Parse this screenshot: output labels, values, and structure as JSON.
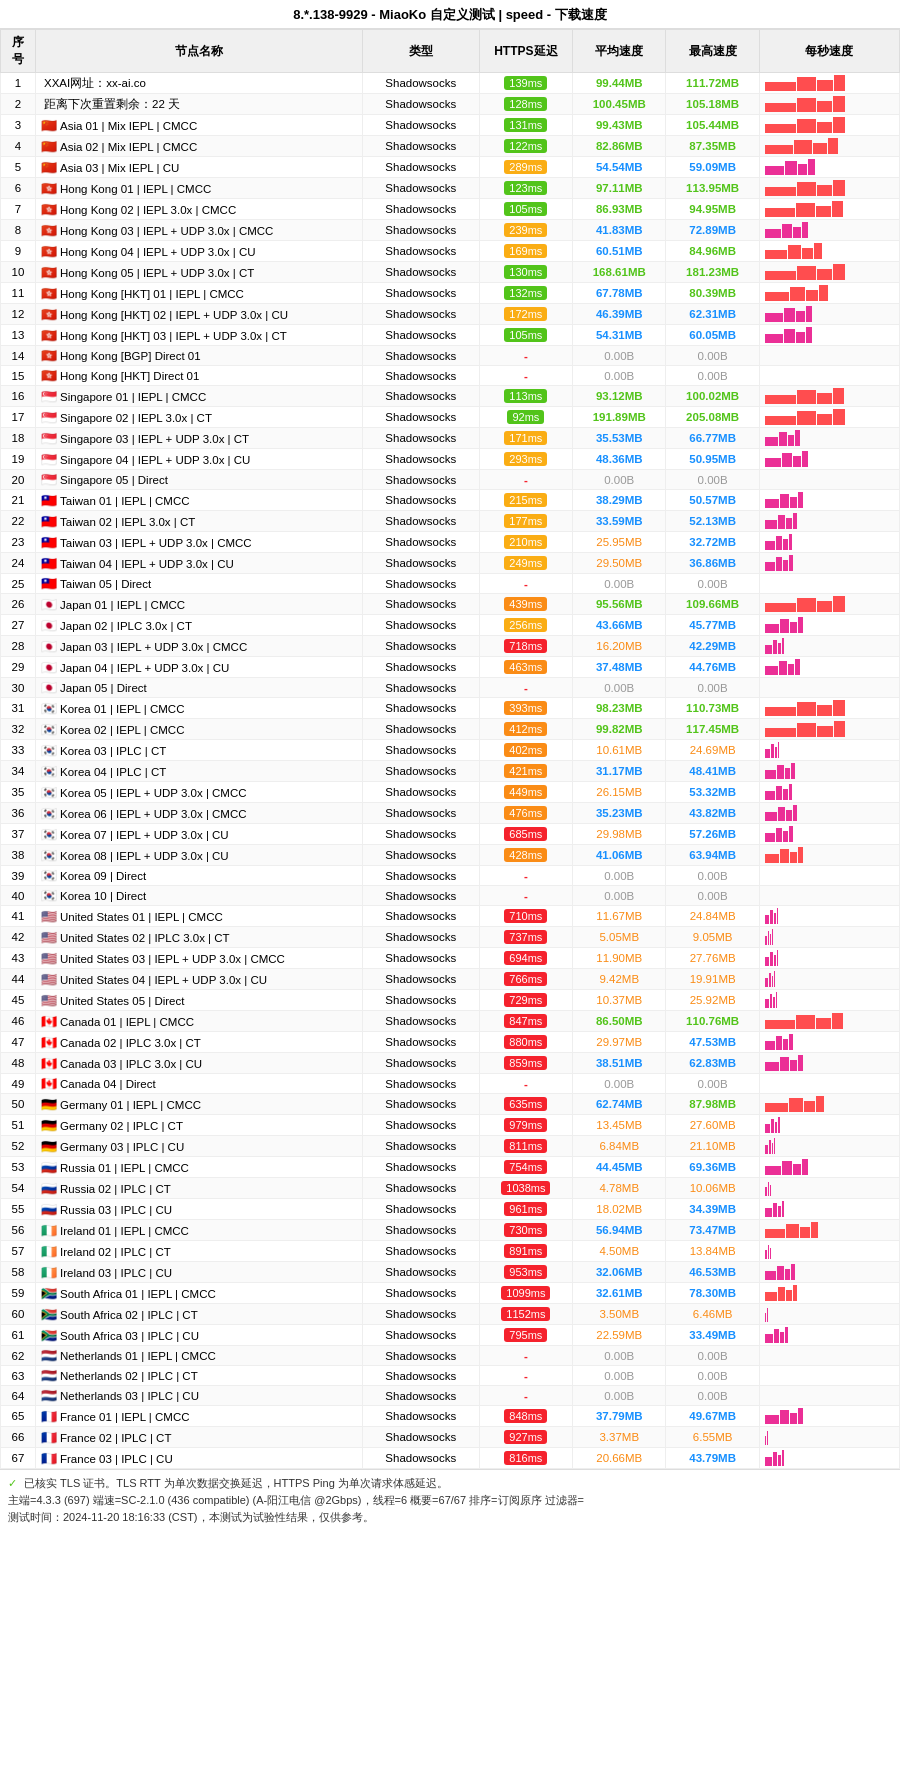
{
  "title": "8.*.138-9929 - MiaoKo 自定义测试 | speed - 下载速度",
  "columns": [
    "序号",
    "节点名称",
    "类型",
    "HTTPS延迟",
    "平均速度",
    "最高速度",
    "每秒速度"
  ],
  "rows": [
    {
      "num": 1,
      "name": "XXAI网址：xx-ai.co",
      "type": "Shadowsocks",
      "https": "139ms",
      "avg": "99.44MB",
      "max": "111.72MB",
      "bar": 95,
      "barColor": "red"
    },
    {
      "num": 2,
      "name": "距离下次重置剩余：22 天",
      "type": "Shadowsocks",
      "https": "128ms",
      "avg": "100.45MB",
      "max": "105.18MB",
      "bar": 98,
      "barColor": "red"
    },
    {
      "num": 3,
      "name": "Asia 01 | Mix IEPL | CMCC",
      "flag": "🇨🇳",
      "type": "Shadowsocks",
      "https": "131ms",
      "avg": "99.43MB",
      "max": "105.44MB",
      "bar": 92,
      "barColor": "red"
    },
    {
      "num": 4,
      "name": "Asia 02 | Mix IEPL | CMCC",
      "flag": "🇨🇳",
      "type": "Shadowsocks",
      "https": "122ms",
      "avg": "82.86MB",
      "max": "87.35MB",
      "bar": 80,
      "barColor": "red"
    },
    {
      "num": 5,
      "name": "Asia 03 | Mix IEPL | CU",
      "flag": "🇨🇳",
      "type": "Shadowsocks",
      "https": "289ms",
      "avg": "54.54MB",
      "max": "59.09MB",
      "bar": 55,
      "barColor": "pink"
    },
    {
      "num": 6,
      "name": "Hong Kong 01 | IEPL | CMCC",
      "flag": "🇭🇰",
      "type": "Shadowsocks",
      "https": "123ms",
      "avg": "97.11MB",
      "max": "113.95MB",
      "bar": 90,
      "barColor": "red"
    },
    {
      "num": 7,
      "name": "Hong Kong 02 | IEPL 3.0x | CMCC",
      "flag": "🇭🇰",
      "type": "Shadowsocks",
      "https": "105ms",
      "avg": "86.93MB",
      "max": "94.95MB",
      "bar": 85,
      "barColor": "red"
    },
    {
      "num": 8,
      "name": "Hong Kong 03 | IEPL + UDP 3.0x | CMCC",
      "flag": "🇭🇰",
      "type": "Shadowsocks",
      "https": "239ms",
      "avg": "41.83MB",
      "max": "72.89MB",
      "bar": 45,
      "barColor": "pink"
    },
    {
      "num": 9,
      "name": "Hong Kong 04 | IEPL + UDP 3.0x | CU",
      "flag": "🇭🇰",
      "type": "Shadowsocks",
      "https": "169ms",
      "avg": "60.51MB",
      "max": "84.96MB",
      "bar": 62,
      "barColor": "red"
    },
    {
      "num": 10,
      "name": "Hong Kong 05 | IEPL + UDP 3.0x | CT",
      "flag": "🇭🇰",
      "type": "Shadowsocks",
      "https": "130ms",
      "avg": "168.61MB",
      "max": "181.23MB",
      "bar": 99,
      "barColor": "red"
    },
    {
      "num": 11,
      "name": "Hong Kong [HKT] 01 | IEPL | CMCC",
      "flag": "🇭🇰",
      "type": "Shadowsocks",
      "https": "132ms",
      "avg": "67.78MB",
      "max": "80.39MB",
      "bar": 68,
      "barColor": "red"
    },
    {
      "num": 12,
      "name": "Hong Kong [HKT] 02 | IEPL + UDP 3.0x | CU",
      "flag": "🇭🇰",
      "type": "Shadowsocks",
      "https": "172ms",
      "avg": "46.39MB",
      "max": "62.31MB",
      "bar": 50,
      "barColor": "pink"
    },
    {
      "num": 13,
      "name": "Hong Kong [HKT] 03 | IEPL + UDP 3.0x | CT",
      "flag": "🇭🇰",
      "type": "Shadowsocks",
      "https": "105ms",
      "avg": "54.31MB",
      "max": "60.05MB",
      "bar": 52,
      "barColor": "pink"
    },
    {
      "num": 14,
      "name": "Hong Kong [BGP] Direct 01",
      "flag": "🇭🇰",
      "type": "Shadowsocks",
      "https": "-",
      "avg": "0.00B",
      "max": "0.00B",
      "bar": 0,
      "barColor": "gray"
    },
    {
      "num": 15,
      "name": "Hong Kong [HKT] Direct 01",
      "flag": "🇭🇰",
      "type": "Shadowsocks",
      "https": "-",
      "avg": "0.00B",
      "max": "0.00B",
      "bar": 0,
      "barColor": "gray"
    },
    {
      "num": 16,
      "name": "Singapore 01 | IEPL | CMCC",
      "flag": "🇸🇬",
      "type": "Shadowsocks",
      "https": "113ms",
      "avg": "93.12MB",
      "max": "100.02MB",
      "bar": 88,
      "barColor": "red"
    },
    {
      "num": 17,
      "name": "Singapore 02 | IEPL 3.0x | CT",
      "flag": "🇸🇬",
      "type": "Shadowsocks",
      "https": "92ms",
      "avg": "191.89MB",
      "max": "205.08MB",
      "bar": 99,
      "barColor": "red"
    },
    {
      "num": 18,
      "name": "Singapore 03 | IEPL + UDP 3.0x | CT",
      "flag": "🇸🇬",
      "type": "Shadowsocks",
      "https": "171ms",
      "avg": "35.53MB",
      "max": "66.77MB",
      "bar": 38,
      "barColor": "pink"
    },
    {
      "num": 19,
      "name": "Singapore 04 | IEPL + UDP 3.0x | CU",
      "flag": "🇸🇬",
      "type": "Shadowsocks",
      "https": "293ms",
      "avg": "48.36MB",
      "max": "50.95MB",
      "bar": 46,
      "barColor": "pink"
    },
    {
      "num": 20,
      "name": "Singapore 05 | Direct",
      "flag": "🇸🇬",
      "type": "Shadowsocks",
      "https": "-",
      "avg": "0.00B",
      "max": "0.00B",
      "bar": 0,
      "barColor": "gray"
    },
    {
      "num": 21,
      "name": "Taiwan 01 | IEPL | CMCC",
      "flag": "🇹🇼",
      "type": "Shadowsocks",
      "https": "215ms",
      "avg": "38.29MB",
      "max": "50.57MB",
      "bar": 40,
      "barColor": "pink"
    },
    {
      "num": 22,
      "name": "Taiwan 02 | IEPL 3.0x | CT",
      "flag": "🇹🇼",
      "type": "Shadowsocks",
      "https": "177ms",
      "avg": "33.59MB",
      "max": "52.13MB",
      "bar": 35,
      "barColor": "pink"
    },
    {
      "num": 23,
      "name": "Taiwan 03 | IEPL + UDP 3.0x | CMCC",
      "flag": "🇹🇼",
      "type": "Shadowsocks",
      "https": "210ms",
      "avg": "25.95MB",
      "max": "32.72MB",
      "bar": 28,
      "barColor": "pink"
    },
    {
      "num": 24,
      "name": "Taiwan 04 | IEPL + UDP 3.0x | CU",
      "flag": "🇹🇼",
      "type": "Shadowsocks",
      "https": "249ms",
      "avg": "29.50MB",
      "max": "36.86MB",
      "bar": 30,
      "barColor": "pink"
    },
    {
      "num": 25,
      "name": "Taiwan 05 | Direct",
      "flag": "🇹🇼",
      "type": "Shadowsocks",
      "https": "-",
      "avg": "0.00B",
      "max": "0.00B",
      "bar": 0,
      "barColor": "gray"
    },
    {
      "num": 26,
      "name": "Japan 01 | IEPL | CMCC",
      "flag": "🇯🇵",
      "type": "Shadowsocks",
      "https": "439ms",
      "avg": "95.56MB",
      "max": "109.66MB",
      "bar": 90,
      "barColor": "red"
    },
    {
      "num": 27,
      "name": "Japan 02 | IPLC 3.0x | CT",
      "flag": "🇯🇵",
      "type": "Shadowsocks",
      "https": "256ms",
      "avg": "43.66MB",
      "max": "45.77MB",
      "bar": 42,
      "barColor": "pink"
    },
    {
      "num": 28,
      "name": "Japan 03 | IEPL + UDP 3.0x | CMCC",
      "flag": "🇯🇵",
      "type": "Shadowsocks",
      "https": "718ms",
      "avg": "16.20MB",
      "max": "42.29MB",
      "bar": 20,
      "barColor": "pink"
    },
    {
      "num": 29,
      "name": "Japan 04 | IEPL + UDP 3.0x | CU",
      "flag": "🇯🇵",
      "type": "Shadowsocks",
      "https": "463ms",
      "avg": "37.48MB",
      "max": "44.76MB",
      "bar": 38,
      "barColor": "pink"
    },
    {
      "num": 30,
      "name": "Japan 05 | Direct",
      "flag": "🇯🇵",
      "type": "Shadowsocks",
      "https": "-",
      "avg": "0.00B",
      "max": "0.00B",
      "bar": 0,
      "barColor": "gray"
    },
    {
      "num": 31,
      "name": "Korea 01 | IEPL | CMCC",
      "flag": "🇰🇷",
      "type": "Shadowsocks",
      "https": "393ms",
      "avg": "98.23MB",
      "max": "110.73MB",
      "bar": 92,
      "barColor": "red"
    },
    {
      "num": 32,
      "name": "Korea 02 | IEPL | CMCC",
      "flag": "🇰🇷",
      "type": "Shadowsocks",
      "https": "412ms",
      "avg": "99.82MB",
      "max": "117.45MB",
      "bar": 95,
      "barColor": "red"
    },
    {
      "num": 33,
      "name": "Korea 03 | IPLC | CT",
      "flag": "🇰🇷",
      "type": "Shadowsocks",
      "https": "402ms",
      "avg": "10.61MB",
      "max": "24.69MB",
      "bar": 15,
      "barColor": "pink"
    },
    {
      "num": 34,
      "name": "Korea 04 | IPLC | CT",
      "flag": "🇰🇷",
      "type": "Shadowsocks",
      "https": "421ms",
      "avg": "31.17MB",
      "max": "48.41MB",
      "bar": 32,
      "barColor": "pink"
    },
    {
      "num": 35,
      "name": "Korea 05 | IEPL + UDP 3.0x | CMCC",
      "flag": "🇰🇷",
      "type": "Shadowsocks",
      "https": "449ms",
      "avg": "26.15MB",
      "max": "53.32MB",
      "bar": 28,
      "barColor": "pink"
    },
    {
      "num": 36,
      "name": "Korea 06 | IEPL + UDP 3.0x | CMCC",
      "flag": "🇰🇷",
      "type": "Shadowsocks",
      "https": "476ms",
      "avg": "35.23MB",
      "max": "43.82MB",
      "bar": 35,
      "barColor": "pink"
    },
    {
      "num": 37,
      "name": "Korea 07 | IEPL + UDP 3.0x | CU",
      "flag": "🇰🇷",
      "type": "Shadowsocks",
      "https": "685ms",
      "avg": "29.98MB",
      "max": "57.26MB",
      "bar": 30,
      "barColor": "pink"
    },
    {
      "num": 38,
      "name": "Korea 08 | IEPL + UDP 3.0x | CU",
      "flag": "🇰🇷",
      "type": "Shadowsocks",
      "https": "428ms",
      "avg": "41.06MB",
      "max": "63.94MB",
      "bar": 42,
      "barColor": "red"
    },
    {
      "num": 39,
      "name": "Korea 09 | Direct",
      "flag": "🇰🇷",
      "type": "Shadowsocks",
      "https": "-",
      "avg": "0.00B",
      "max": "0.00B",
      "bar": 0,
      "barColor": "gray"
    },
    {
      "num": 40,
      "name": "Korea 10 | Direct",
      "flag": "🇰🇷",
      "type": "Shadowsocks",
      "https": "-",
      "avg": "0.00B",
      "max": "0.00B",
      "bar": 0,
      "barColor": "gray"
    },
    {
      "num": 41,
      "name": "United States 01 | IEPL | CMCC",
      "flag": "🇺🇸",
      "type": "Shadowsocks",
      "https": "710ms",
      "avg": "11.67MB",
      "max": "24.84MB",
      "bar": 14,
      "barColor": "pink"
    },
    {
      "num": 42,
      "name": "United States 02 | IPLC 3.0x | CT",
      "flag": "🇺🇸",
      "type": "Shadowsocks",
      "https": "737ms",
      "avg": "5.05MB",
      "max": "9.05MB",
      "bar": 8,
      "barColor": "pink"
    },
    {
      "num": 43,
      "name": "United States 03 | IEPL + UDP 3.0x | CMCC",
      "flag": "🇺🇸",
      "type": "Shadowsocks",
      "https": "694ms",
      "avg": "11.90MB",
      "max": "27.76MB",
      "bar": 14,
      "barColor": "pink"
    },
    {
      "num": 44,
      "name": "United States 04 | IEPL + UDP 3.0x | CU",
      "flag": "🇺🇸",
      "type": "Shadowsocks",
      "https": "766ms",
      "avg": "9.42MB",
      "max": "19.91MB",
      "bar": 11,
      "barColor": "pink"
    },
    {
      "num": 45,
      "name": "United States 05 | Direct",
      "flag": "🇺🇸",
      "type": "Shadowsocks",
      "https": "729ms",
      "avg": "10.37MB",
      "max": "25.92MB",
      "bar": 13,
      "barColor": "pink"
    },
    {
      "num": 46,
      "name": "Canada 01 | IEPL | CMCC",
      "flag": "🇨🇦",
      "type": "Shadowsocks",
      "https": "847ms",
      "avg": "86.50MB",
      "max": "110.76MB",
      "bar": 85,
      "barColor": "red"
    },
    {
      "num": 47,
      "name": "Canada 02 | IPLC 3.0x | CT",
      "flag": "🇨🇦",
      "type": "Shadowsocks",
      "https": "880ms",
      "avg": "29.97MB",
      "max": "47.53MB",
      "bar": 30,
      "barColor": "pink"
    },
    {
      "num": 48,
      "name": "Canada 03 | IPLC 3.0x | CU",
      "flag": "🇨🇦",
      "type": "Shadowsocks",
      "https": "859ms",
      "avg": "38.51MB",
      "max": "62.83MB",
      "bar": 40,
      "barColor": "pink"
    },
    {
      "num": 49,
      "name": "Canada 04 | Direct",
      "flag": "🇨🇦",
      "type": "Shadowsocks",
      "https": "-",
      "avg": "0.00B",
      "max": "0.00B",
      "bar": 0,
      "barColor": "gray"
    },
    {
      "num": 50,
      "name": "Germany 01 | IEPL | CMCC",
      "flag": "🇩🇪",
      "type": "Shadowsocks",
      "https": "635ms",
      "avg": "62.74MB",
      "max": "87.98MB",
      "bar": 65,
      "barColor": "red"
    },
    {
      "num": 51,
      "name": "Germany 02 | IPLC | CT",
      "flag": "🇩🇪",
      "type": "Shadowsocks",
      "https": "979ms",
      "avg": "13.45MB",
      "max": "27.60MB",
      "bar": 16,
      "barColor": "pink"
    },
    {
      "num": 52,
      "name": "Germany 03 | IPLC | CU",
      "flag": "🇩🇪",
      "type": "Shadowsocks",
      "https": "811ms",
      "avg": "6.84MB",
      "max": "21.10MB",
      "bar": 9,
      "barColor": "pink"
    },
    {
      "num": 53,
      "name": "Russia 01 | IEPL | CMCC",
      "flag": "🇷🇺",
      "type": "Shadowsocks",
      "https": "754ms",
      "avg": "44.45MB",
      "max": "69.36MB",
      "bar": 46,
      "barColor": "pink"
    },
    {
      "num": 54,
      "name": "Russia 02 | IPLC | CT",
      "flag": "🇷🇺",
      "type": "Shadowsocks",
      "https": "1038ms",
      "avg": "4.78MB",
      "max": "10.06MB",
      "bar": 7,
      "barColor": "pink"
    },
    {
      "num": 55,
      "name": "Russia 03 | IPLC | CU",
      "flag": "🇷🇺",
      "type": "Shadowsocks",
      "https": "961ms",
      "avg": "18.02MB",
      "max": "34.39MB",
      "bar": 20,
      "barColor": "pink"
    },
    {
      "num": 56,
      "name": "Ireland 01 | IEPL | CMCC",
      "flag": "🇮🇪",
      "type": "Shadowsocks",
      "https": "730ms",
      "avg": "56.94MB",
      "max": "73.47MB",
      "bar": 58,
      "barColor": "red"
    },
    {
      "num": 57,
      "name": "Ireland 02 | IPLC | CT",
      "flag": "🇮🇪",
      "type": "Shadowsocks",
      "https": "891ms",
      "avg": "4.50MB",
      "max": "13.84MB",
      "bar": 7,
      "barColor": "pink"
    },
    {
      "num": 58,
      "name": "Ireland 03 | IPLC | CU",
      "flag": "🇮🇪",
      "type": "Shadowsocks",
      "https": "953ms",
      "avg": "32.06MB",
      "max": "46.53MB",
      "bar": 33,
      "barColor": "pink"
    },
    {
      "num": 59,
      "name": "South Africa 01 | IEPL | CMCC",
      "flag": "🇿🇦",
      "type": "Shadowsocks",
      "https": "1099ms",
      "avg": "32.61MB",
      "max": "78.30MB",
      "bar": 35,
      "barColor": "red"
    },
    {
      "num": 60,
      "name": "South Africa 02 | IPLC | CT",
      "flag": "🇿🇦",
      "type": "Shadowsocks",
      "https": "1152ms",
      "avg": "3.50MB",
      "max": "6.46MB",
      "bar": 5,
      "barColor": "pink"
    },
    {
      "num": 61,
      "name": "South Africa 03 | IPLC | CU",
      "flag": "🇿🇦",
      "type": "Shadowsocks",
      "https": "795ms",
      "avg": "22.59MB",
      "max": "33.49MB",
      "bar": 24,
      "barColor": "pink"
    },
    {
      "num": 62,
      "name": "Netherlands 01 | IEPL | CMCC",
      "flag": "🇳🇱",
      "type": "Shadowsocks",
      "https": "-",
      "avg": "0.00B",
      "max": "0.00B",
      "bar": 0,
      "barColor": "gray"
    },
    {
      "num": 63,
      "name": "Netherlands 02 | IPLC | CT",
      "flag": "🇳🇱",
      "type": "Shadowsocks",
      "https": "-",
      "avg": "0.00B",
      "max": "0.00B",
      "bar": 0,
      "barColor": "gray"
    },
    {
      "num": 64,
      "name": "Netherlands 03 | IPLC | CU",
      "flag": "🇳🇱",
      "type": "Shadowsocks",
      "https": "-",
      "avg": "0.00B",
      "max": "0.00B",
      "bar": 0,
      "barColor": "gray"
    },
    {
      "num": 65,
      "name": "France 01 | IEPL | CMCC",
      "flag": "🇫🇷",
      "type": "Shadowsocks",
      "https": "848ms",
      "avg": "37.79MB",
      "max": "49.67MB",
      "bar": 40,
      "barColor": "pink"
    },
    {
      "num": 66,
      "name": "France 02 | IPLC | CT",
      "flag": "🇫🇷",
      "type": "Shadowsocks",
      "https": "927ms",
      "avg": "3.37MB",
      "max": "6.55MB",
      "bar": 5,
      "barColor": "pink"
    },
    {
      "num": 67,
      "name": "France 03 | IPLC | CU",
      "flag": "🇫🇷",
      "type": "Shadowsocks",
      "https": "816ms",
      "avg": "20.66MB",
      "max": "43.79MB",
      "bar": 22,
      "barColor": "pink"
    }
  ],
  "footer": {
    "line1": "✓ 已核实 TLS 证书。TLS RTT 为单次数据交换延迟，HTTPS Ping 为单次请求体感延迟。",
    "line2": "主端=4.3.3 (697) 端速=SC-2.1.0 (436 compatible) (A-阳江电信 @2Gbps)，线程=6 概要=67/67 排序=订阅原序 过滤器=",
    "line3": "测试时间：2024-11-20 18:16:33 (CST)，本测试为试验性结果，仅供参考。"
  }
}
